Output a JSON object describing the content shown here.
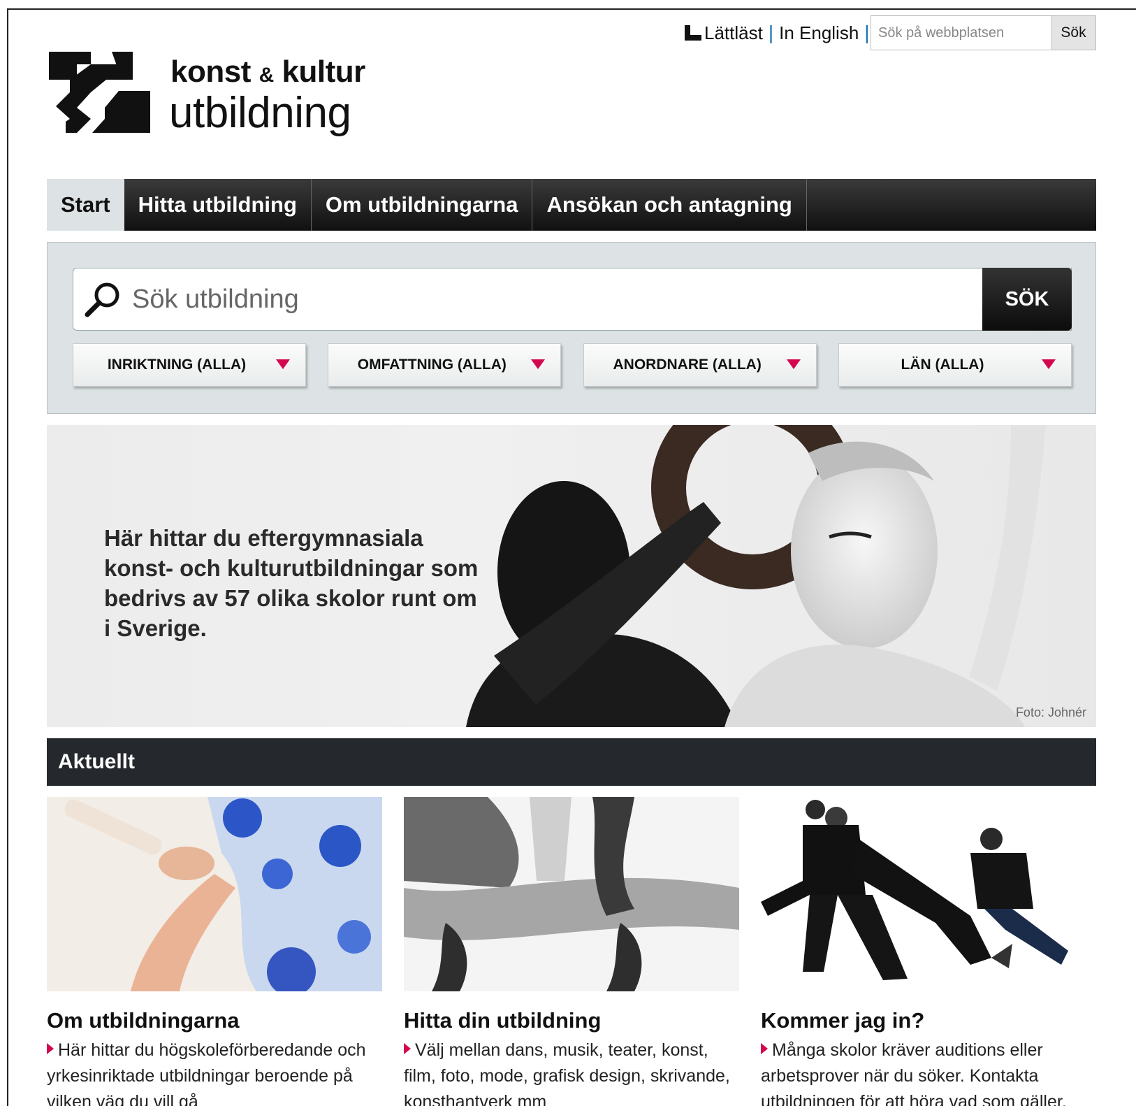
{
  "utility": {
    "easy_read": "Lättläst",
    "english": "In English",
    "search_placeholder": "Sök på webbplatsen",
    "search_button": "Sök"
  },
  "logo": {
    "line1_a": "konst",
    "line1_amp": "&",
    "line1_b": "kultur",
    "line2": "utbildning"
  },
  "nav": {
    "tabs": [
      {
        "label": "Start",
        "active": true
      },
      {
        "label": "Hitta utbildning",
        "active": false
      },
      {
        "label": "Om utbildningarna",
        "active": false
      },
      {
        "label": "Ansökan och antagning",
        "active": false
      }
    ]
  },
  "search": {
    "placeholder": "Sök utbildning",
    "button": "SÖK",
    "filters": [
      {
        "label": "INRIKTNING (ALLA)"
      },
      {
        "label": "OMFATTNING (ALLA)"
      },
      {
        "label": "ANORDNARE (ALLA)"
      },
      {
        "label": "LÄN (ALLA)"
      }
    ]
  },
  "hero": {
    "text": "Här hittar du eftergymnasiala konst- och kulturutbildningar som bedrivs av 57 olika skolor runt om i Sverige.",
    "credit": "Foto: Johnér"
  },
  "aktuellt": {
    "title": "Aktuellt",
    "cards": [
      {
        "title": "Om utbildningarna",
        "text": "Här hittar du högskoleförberedande och yrkesinriktade utbildningar beroende på vilken väg du vill gå"
      },
      {
        "title": "Hitta din utbildning",
        "text": "Välj mellan dans, musik, teater, konst, film, foto, mode, grafisk design, skrivande, konsthantverk mm"
      },
      {
        "title": "Kommer jag in?",
        "text": "Många skolor kräver auditions eller arbetsprover när du söker. Kontakta utbildningen för att höra vad som gäller."
      }
    ]
  },
  "colors": {
    "accent": "#d4064e",
    "nav_bg": "#1a1a1a",
    "panel_bg": "#dde3e4",
    "section_bar": "#25292d"
  }
}
